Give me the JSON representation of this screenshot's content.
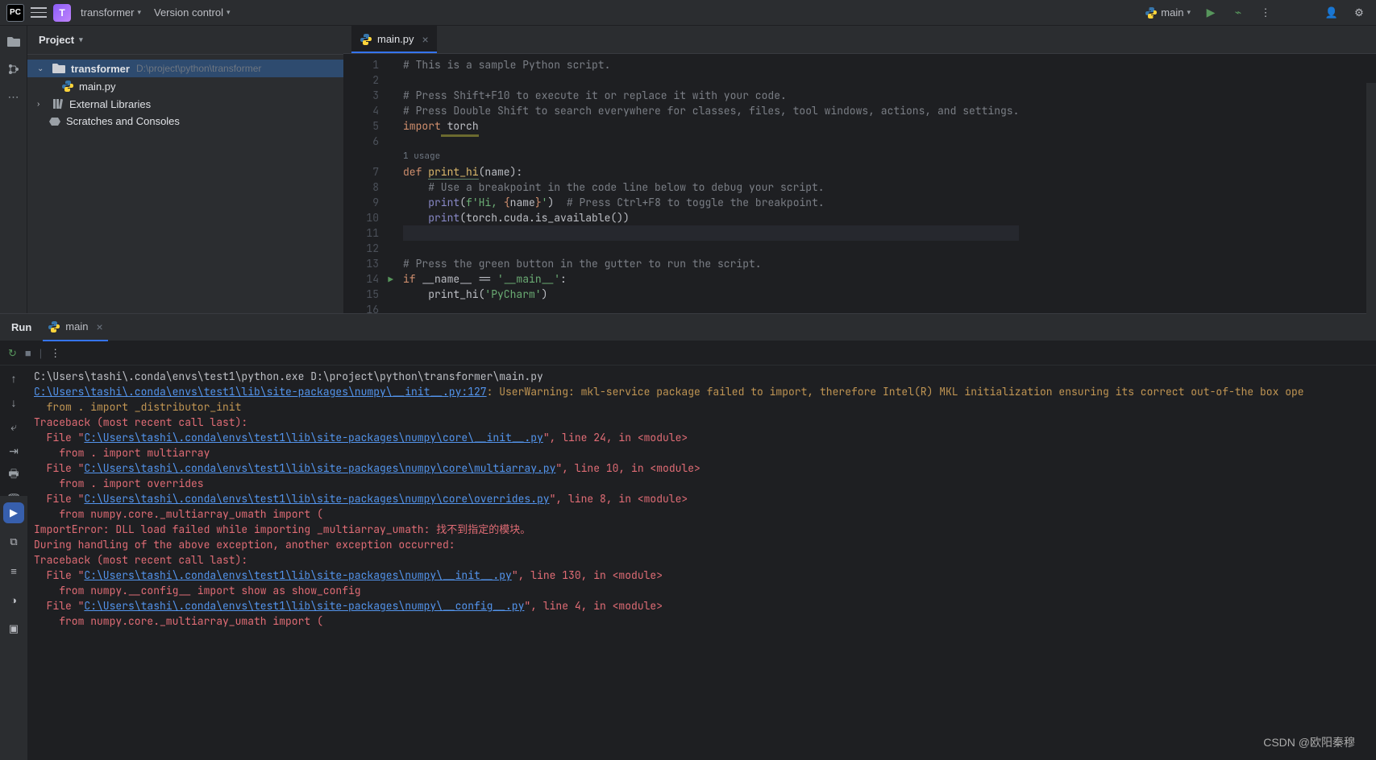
{
  "header": {
    "project_name": "transformer",
    "project_initial": "T",
    "vc_label": "Version control",
    "run_config": "main"
  },
  "project_panel": {
    "title": "Project",
    "root": {
      "name": "transformer",
      "path": "D:\\project\\python\\transformer"
    },
    "file": "main.py",
    "ext_lib": "External Libraries",
    "scratch": "Scratches and Consoles"
  },
  "editor": {
    "tab": "main.py",
    "usage_hint": "1 usage",
    "lines": [
      1,
      2,
      3,
      4,
      5,
      6,
      7,
      8,
      9,
      10,
      11,
      12,
      13,
      14,
      15,
      16
    ],
    "l1": "# This is a sample Python script.",
    "l3": "# Press Shift+F10 to execute it or replace it with your code.",
    "l4": "# Press Double Shift to search everywhere for classes, files, tool windows, actions, and settings.",
    "l5_kw": "import",
    "l5_id": " torch",
    "l7_def": "def ",
    "l7_fn": "print_hi",
    "l7_rest": "(name):",
    "l8": "    # Use a breakpoint in the code line below to debug your script.",
    "l9_a": "    ",
    "l9_print": "print",
    "l9_b": "(",
    "l9_f": "f'Hi, ",
    "l9_brace": "{",
    "l9_name": "name",
    "l9_brace2": "}",
    "l9_end": "'",
    "l9_c": ")  ",
    "l9_cmt": "# Press Ctrl+F8 to toggle the breakpoint.",
    "l10_a": "    ",
    "l10_print": "print",
    "l10_b": "(torch.cuda.is_available())",
    "l13": "# Press the green button in the gutter to run the script.",
    "l14_if": "if ",
    "l14_name": "__name__",
    "l14_eq": " == ",
    "l14_main": "'__main__'",
    "l14_colon": ":",
    "l15_a": "    print_hi(",
    "l15_s": "'PyCharm'",
    "l15_b": ")"
  },
  "run": {
    "title": "Run",
    "tab": "main",
    "console": {
      "cmd": "C:\\Users\\tashi\\.conda\\envs\\test1\\python.exe D:\\project\\python\\transformer\\main.py",
      "warn_link": "C:\\Users\\tashi\\.conda\\envs\\test1\\lib\\site-packages\\numpy\\__init__.py:127",
      "warn_txt": ": UserWarning: mkl-service package failed to import, therefore Intel(R) MKL initialization ensuring its correct out-of-the box ope",
      "warn2": "  from . import _distributor_init",
      "tb": "Traceback (most recent call last):",
      "f1a": "  File \"",
      "f1link": "C:\\Users\\tashi\\.conda\\envs\\test1\\lib\\site-packages\\numpy\\core\\__init__.py",
      "f1b": "\", line 24, in <module>",
      "f1src": "    from . import multiarray",
      "f2a": "  File \"",
      "f2link": "C:\\Users\\tashi\\.conda\\envs\\test1\\lib\\site-packages\\numpy\\core\\multiarray.py",
      "f2b": "\", line 10, in <module>",
      "f2src": "    from . import overrides",
      "f3a": "  File \"",
      "f3link": "C:\\Users\\tashi\\.conda\\envs\\test1\\lib\\site-packages\\numpy\\core\\overrides.py",
      "f3b": "\", line 8, in <module>",
      "f3src": "    from numpy.core._multiarray_umath import (",
      "imperr": "ImportError: DLL load failed while importing _multiarray_umath: 找不到指定的模块。",
      "during": "During handling of the above exception, another exception occurred:",
      "tb2": "Traceback (most recent call last):",
      "f4a": "  File \"",
      "f4link": "C:\\Users\\tashi\\.conda\\envs\\test1\\lib\\site-packages\\numpy\\__init__.py",
      "f4b": "\", line 130, in <module>",
      "f4src": "    from numpy.__config__ import show as show_config",
      "f5a": "  File \"",
      "f5link": "C:\\Users\\tashi\\.conda\\envs\\test1\\lib\\site-packages\\numpy\\__config__.py",
      "f5b": "\", line 4, in <module>",
      "f5src": "    from numpy.core._multiarray_umath import ("
    }
  },
  "watermark": "CSDN @欧阳秦穆"
}
